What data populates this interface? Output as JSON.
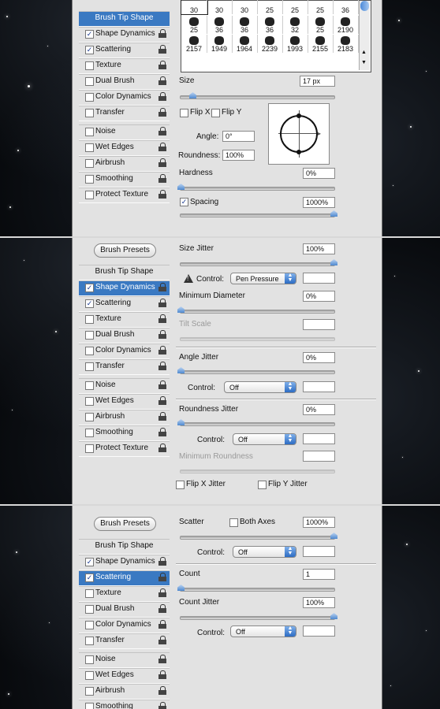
{
  "panel_top": {
    "sidebar": {
      "items": [
        {
          "label": "Brush Tip Shape",
          "checked": null,
          "selected": true
        },
        {
          "label": "Shape Dynamics",
          "checked": true
        },
        {
          "label": "Scattering",
          "checked": true
        },
        {
          "label": "Texture",
          "checked": false
        },
        {
          "label": "Dual Brush",
          "checked": false
        },
        {
          "label": "Color Dynamics",
          "checked": false
        },
        {
          "label": "Transfer",
          "checked": false
        },
        {
          "label": "Noise",
          "checked": false
        },
        {
          "label": "Wet Edges",
          "checked": false
        },
        {
          "label": "Airbrush",
          "checked": false
        },
        {
          "label": "Smoothing",
          "checked": false
        },
        {
          "label": "Protect Texture",
          "checked": false
        }
      ]
    },
    "brush_grid": {
      "row1": [
        "30",
        "30",
        "30",
        "25",
        "25",
        "25",
        "36"
      ],
      "row2": [
        "25",
        "36",
        "36",
        "36",
        "32",
        "25",
        "2190"
      ],
      "row3": [
        "2157",
        "1949",
        "1964",
        "2239",
        "1993",
        "2155",
        "2183"
      ]
    },
    "size_label": "Size",
    "size_value": "17 px",
    "flip_x": "Flip X",
    "flip_y": "Flip Y",
    "angle_label": "Angle:",
    "angle_value": "0°",
    "roundness_label": "Roundness:",
    "roundness_value": "100%",
    "hardness_label": "Hardness",
    "hardness_value": "0%",
    "spacing_label": "Spacing",
    "spacing_value": "1000%"
  },
  "panel_mid": {
    "presets_button": "Brush Presets",
    "sidebar": {
      "items": [
        {
          "label": "Brush Tip Shape",
          "checked": null
        },
        {
          "label": "Shape Dynamics",
          "checked": true,
          "selected": true
        },
        {
          "label": "Scattering",
          "checked": true
        },
        {
          "label": "Texture",
          "checked": false
        },
        {
          "label": "Dual Brush",
          "checked": false
        },
        {
          "label": "Color Dynamics",
          "checked": false
        },
        {
          "label": "Transfer",
          "checked": false
        },
        {
          "label": "Noise",
          "checked": false
        },
        {
          "label": "Wet Edges",
          "checked": false
        },
        {
          "label": "Airbrush",
          "checked": false
        },
        {
          "label": "Smoothing",
          "checked": false
        },
        {
          "label": "Protect Texture",
          "checked": false
        }
      ]
    },
    "size_jitter_label": "Size Jitter",
    "size_jitter_value": "100%",
    "control_label": "Control:",
    "size_control_value": "Pen Pressure",
    "min_diameter_label": "Minimum Diameter",
    "min_diameter_value": "0%",
    "tilt_scale_label": "Tilt Scale",
    "angle_jitter_label": "Angle Jitter",
    "angle_jitter_value": "0%",
    "angle_control_value": "Off",
    "roundness_jitter_label": "Roundness Jitter",
    "roundness_jitter_value": "0%",
    "roundness_control_value": "Off",
    "min_roundness_label": "Minimum Roundness",
    "flip_x_jitter": "Flip X Jitter",
    "flip_y_jitter": "Flip Y Jitter"
  },
  "panel_bot": {
    "presets_button": "Brush Presets",
    "sidebar": {
      "items": [
        {
          "label": "Brush Tip Shape",
          "checked": null
        },
        {
          "label": "Shape Dynamics",
          "checked": true
        },
        {
          "label": "Scattering",
          "checked": true,
          "selected": true
        },
        {
          "label": "Texture",
          "checked": false
        },
        {
          "label": "Dual Brush",
          "checked": false
        },
        {
          "label": "Color Dynamics",
          "checked": false
        },
        {
          "label": "Transfer",
          "checked": false
        },
        {
          "label": "Noise",
          "checked": false
        },
        {
          "label": "Wet Edges",
          "checked": false
        },
        {
          "label": "Airbrush",
          "checked": false
        },
        {
          "label": "Smoothing",
          "checked": false
        }
      ]
    },
    "scatter_label": "Scatter",
    "both_axes": "Both Axes",
    "scatter_value": "1000%",
    "control_label": "Control:",
    "scatter_control_value": "Off",
    "count_label": "Count",
    "count_value": "1",
    "count_jitter_label": "Count Jitter",
    "count_jitter_value": "100%",
    "count_control_value": "Off"
  },
  "colors": {
    "selection": "#3a79c2",
    "panel": "#e2e2e2",
    "slider_thumb": "#4f89cf"
  }
}
